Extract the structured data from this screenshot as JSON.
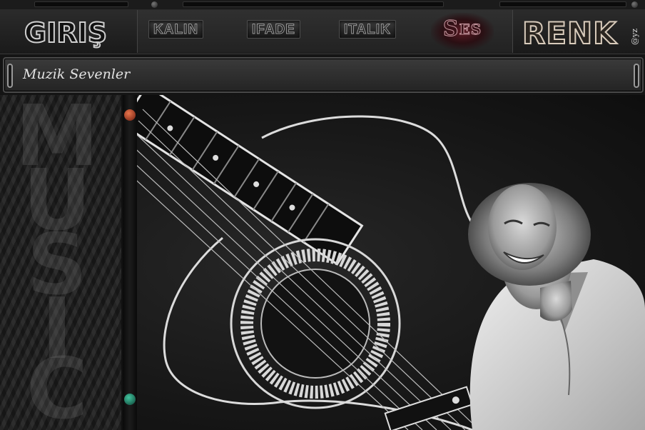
{
  "menu": {
    "logo": "GIRIŞ",
    "bold_label": "KALIN",
    "expression_label": "IFADE",
    "italic_label": "ITALIK",
    "sound_label_main": "S",
    "sound_label_sup": "ES",
    "color_label": "RENK",
    "signature": "@yz"
  },
  "title_bar": {
    "text": "Muzik Sevenler"
  },
  "sidebar": {
    "letters": [
      "M",
      "U",
      "S",
      "I",
      "C"
    ]
  },
  "icons": {
    "top_orb": "red-orb-icon",
    "bottom_orb": "green-orb-icon",
    "pins": "scroll-pin-icon"
  },
  "colors": {
    "accent_ses": "#5a1b24",
    "orb_red": "#c3492a",
    "orb_green": "#1f8e72",
    "background": "#141414"
  },
  "scene": {
    "subject": "guitar-and-laughing-woman-artwork"
  }
}
